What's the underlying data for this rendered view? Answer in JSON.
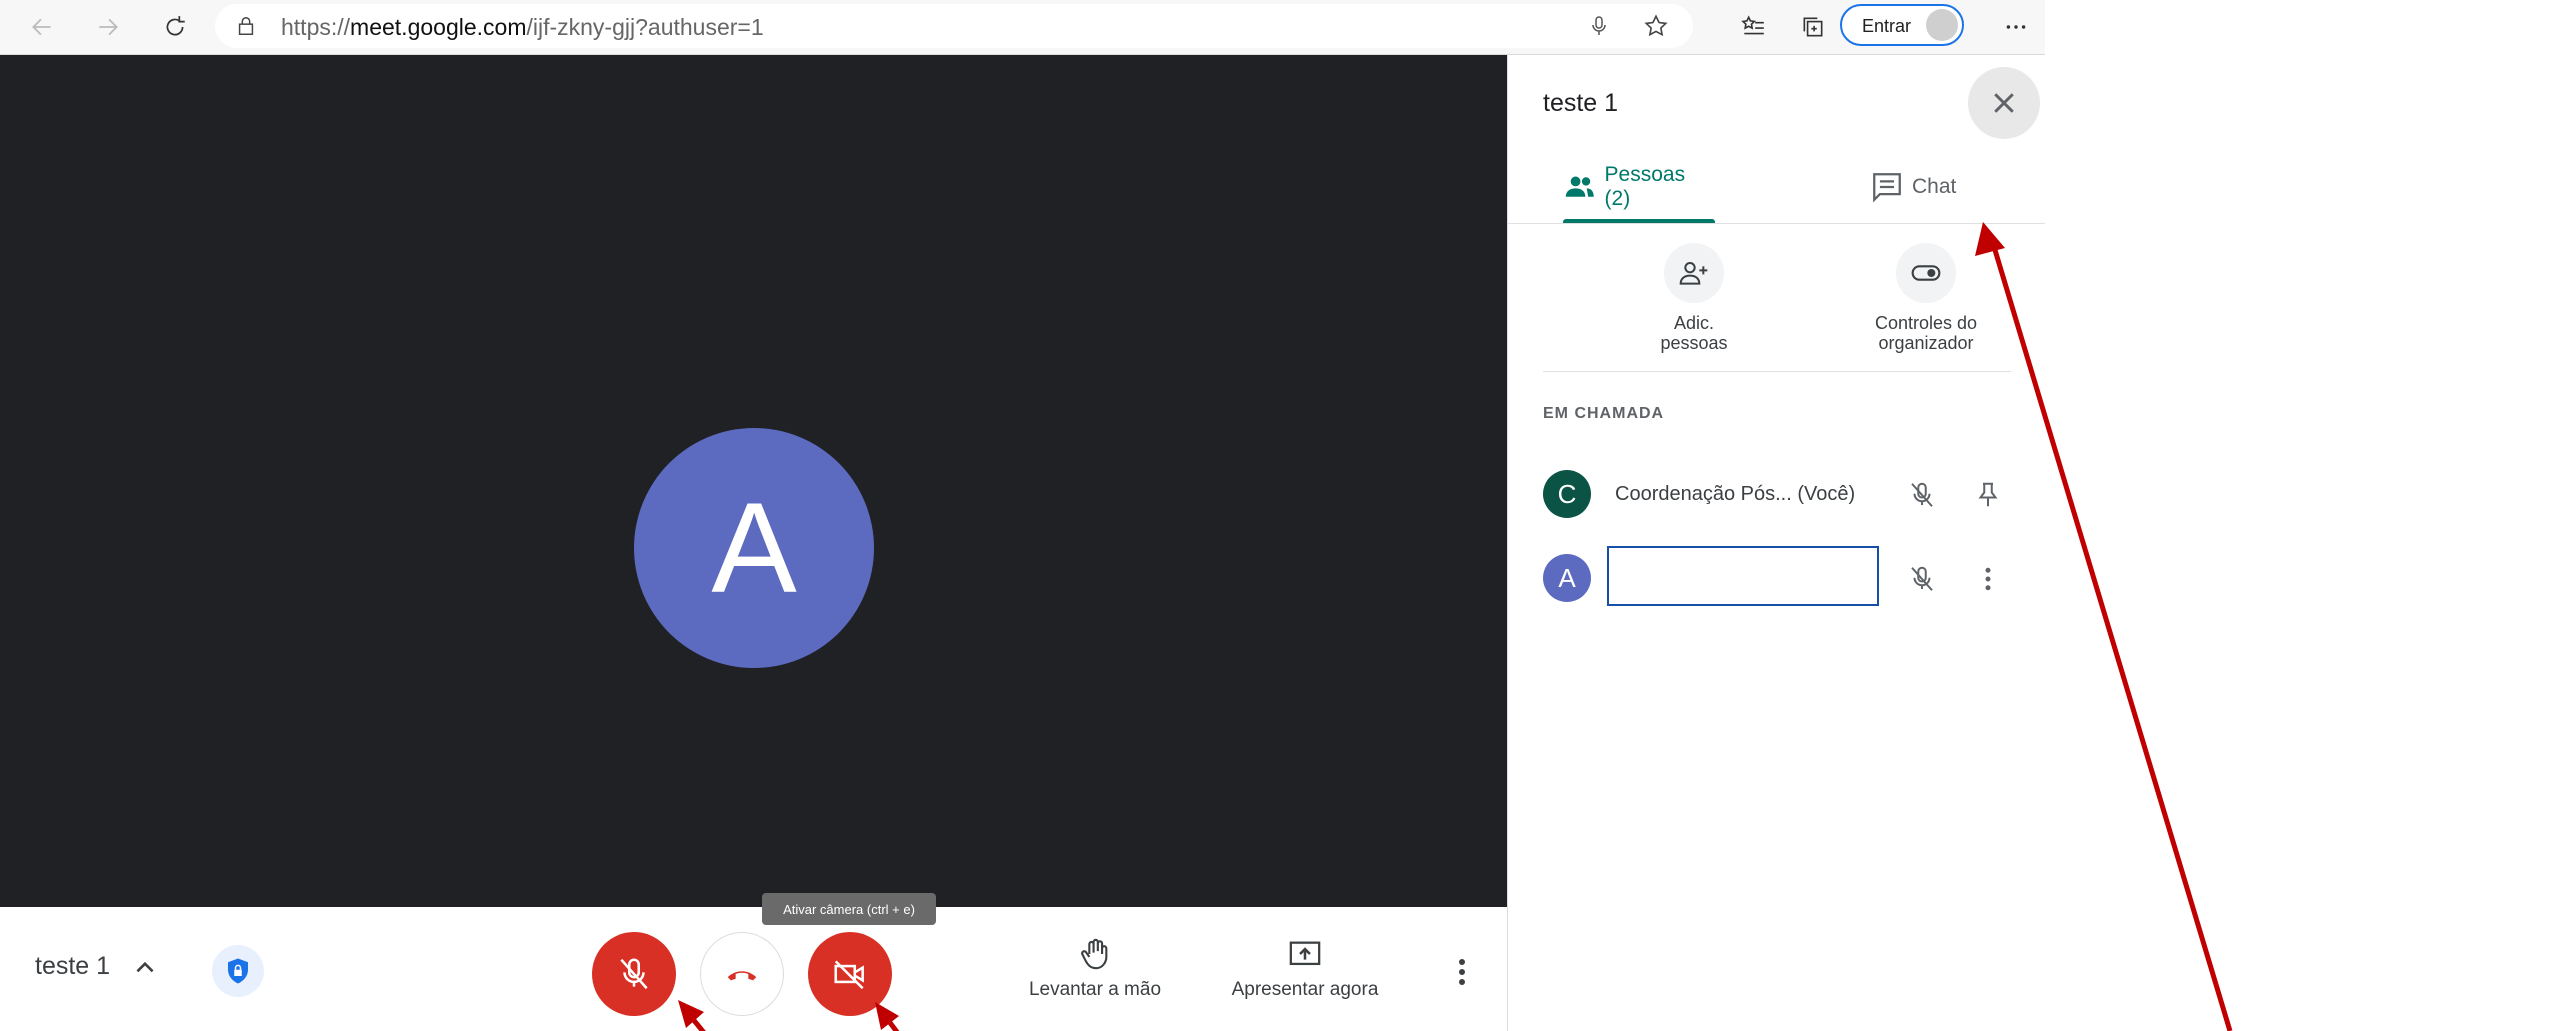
{
  "browser": {
    "url_prefix": "https://",
    "url_domain": "meet.google.com",
    "url_path": "/ijf-zkny-gjj?authuser=1",
    "signin_label": "Entrar"
  },
  "meeting": {
    "title": "teste 1",
    "participant_initial": "A",
    "tooltip": "Ativar câmera (ctrl + e)",
    "raise_hand_label": "Levantar a mão",
    "present_label": "Apresentar agora"
  },
  "panel": {
    "title": "teste 1",
    "tab_people": "Pessoas (2)",
    "tab_chat": "Chat",
    "add_people_label_1": "Adic.",
    "add_people_label_2": "pessoas",
    "host_controls_label_1": "Controles do",
    "host_controls_label_2": "organizador",
    "section_label": "EM CHAMADA",
    "participants": [
      {
        "initial": "C",
        "name": "Coordenação Pós...",
        "suffix": "(Você)",
        "color": "#0b5345"
      },
      {
        "initial": "A",
        "name": "",
        "suffix": "",
        "color": "#5c6bc0"
      }
    ]
  },
  "colors": {
    "accent": "#00796b",
    "danger": "#d93025",
    "stage": "#202124",
    "annotation": "#c00000"
  }
}
